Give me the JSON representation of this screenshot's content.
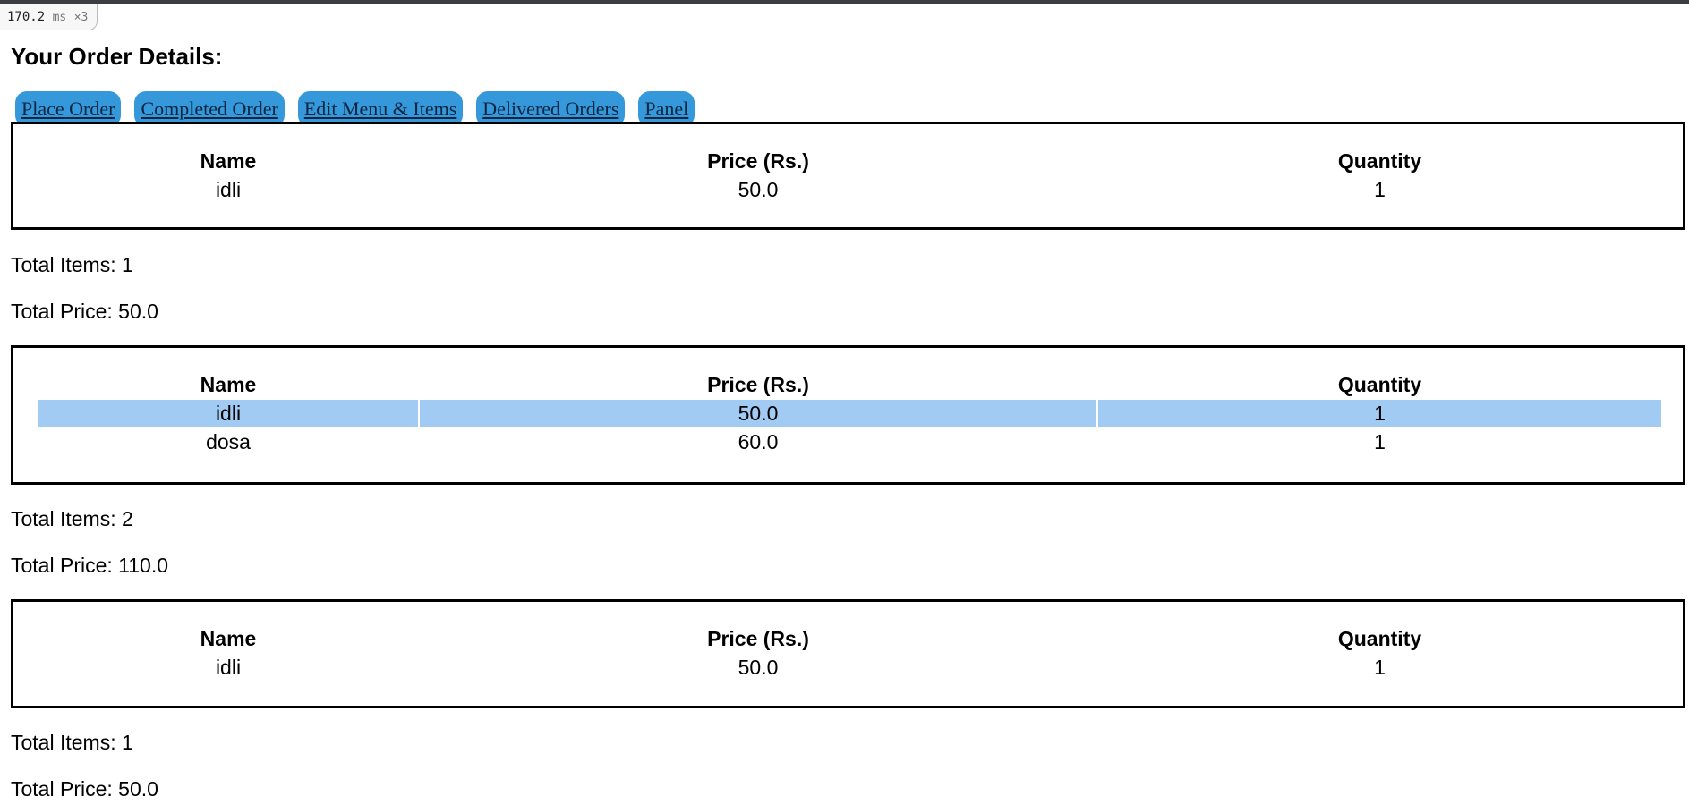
{
  "timing": {
    "value": "170.2",
    "unit": "ms",
    "multiplier": "×3"
  },
  "page_title": "Your Order Details:",
  "nav": [
    {
      "label": "Place Order"
    },
    {
      "label": "Completed Order"
    },
    {
      "label": "Edit Menu & Items "
    },
    {
      "label": "Delivered Orders"
    },
    {
      "label": "Panel"
    }
  ],
  "table_headers": {
    "name": "Name",
    "price": "Price (Rs.)",
    "quantity": "Quantity"
  },
  "summary_labels": {
    "total_items": "Total Items: ",
    "total_price": "Total Price: "
  },
  "orders": [
    {
      "items": [
        {
          "name": "idli",
          "price": "50.0",
          "quantity": "1"
        }
      ],
      "total_items": "1",
      "total_price": "50.0"
    },
    {
      "items": [
        {
          "name": "idli",
          "price": "50.0",
          "quantity": "1"
        },
        {
          "name": "dosa",
          "price": "60.0",
          "quantity": "1"
        }
      ],
      "total_items": "2",
      "total_price": "110.0"
    },
    {
      "items": [
        {
          "name": "idli",
          "price": "50.0",
          "quantity": "1"
        }
      ],
      "total_items": "1",
      "total_price": "50.0"
    }
  ],
  "colors": {
    "nav_button_bg": "#3498db",
    "row_highlight": "#a2cbf4",
    "border": "#000000"
  }
}
